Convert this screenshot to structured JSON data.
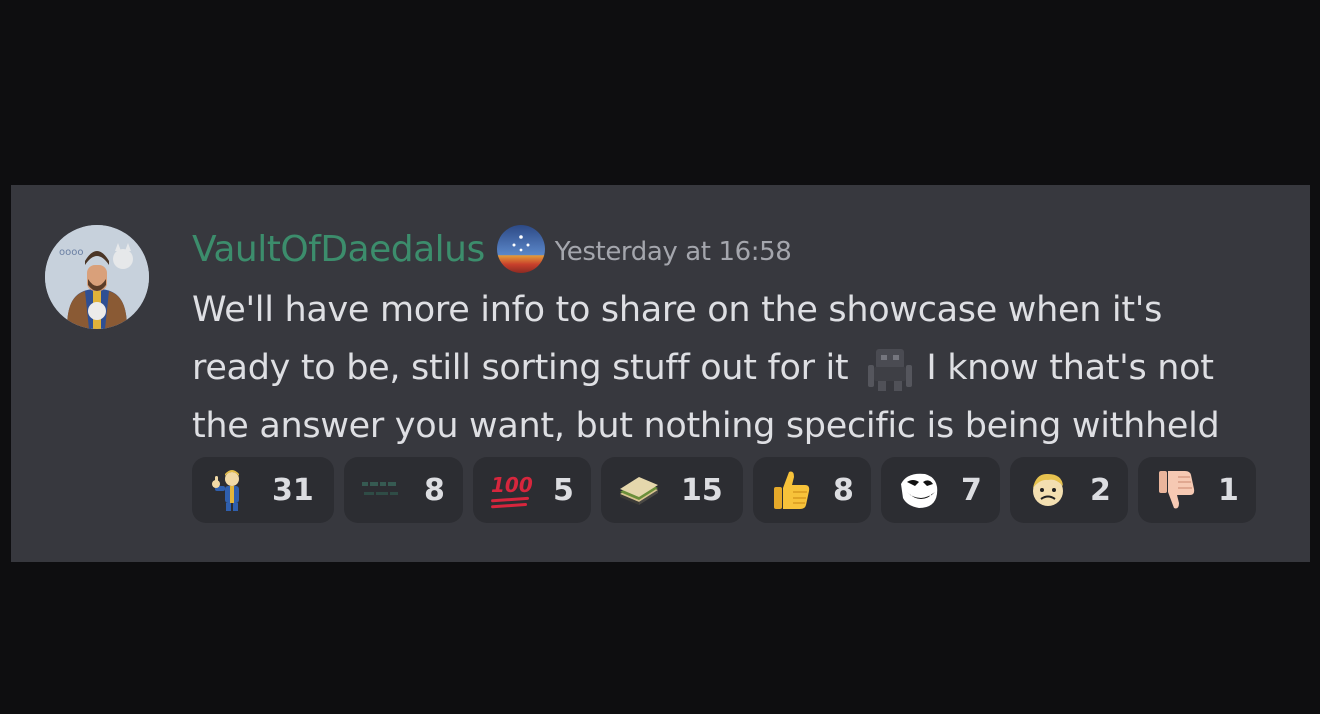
{
  "message": {
    "author": {
      "username": "VaultOfDaedalus",
      "username_color": "#3c8d6c",
      "avatar_icon": "fallout-character-avatar",
      "badge_icon": "starfield-planet-badge"
    },
    "timestamp": "Yesterday at 16:58",
    "content_lines": [
      "We'll have more info to share on the showcase when it's",
      "ready to be, still sorting stuff out for it",
      "I know that's not",
      "the answer you want, but nothing specific is being withheld"
    ],
    "inline_emoji": "shadowed-robot-emoji"
  },
  "reactions": [
    {
      "emoji": "vault-boy-thumbs-up-icon",
      "count": "31"
    },
    {
      "emoji": "green-pixel-text-icon",
      "count": "8"
    },
    {
      "emoji": "hundred-points-icon",
      "count": "5"
    },
    {
      "emoji": "sandwich-icon",
      "count": "15"
    },
    {
      "emoji": "thumbs-up-icon",
      "count": "8"
    },
    {
      "emoji": "trollface-icon",
      "count": "7"
    },
    {
      "emoji": "vault-boy-face-icon",
      "count": "2"
    },
    {
      "emoji": "thumbs-down-icon",
      "count": "1"
    }
  ],
  "colors": {
    "page_background": "#0e0e10",
    "card_background": "#37383e",
    "reaction_background": "#2c2d32",
    "text": "#dedfe3",
    "timestamp": "#a4a6ad"
  }
}
